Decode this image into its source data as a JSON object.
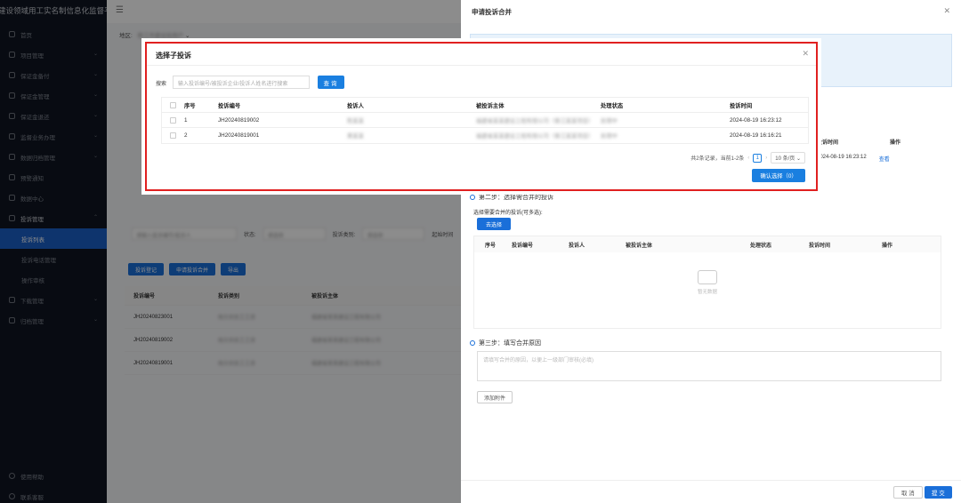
{
  "sidebar": {
    "title": "建设领域用工实名制信息化监督平台",
    "items": [
      {
        "label": "首页"
      },
      {
        "label": "项目管理"
      },
      {
        "label": "保证金备付"
      },
      {
        "label": "保证金管理"
      },
      {
        "label": "保证金退还"
      },
      {
        "label": "监督业务办理"
      },
      {
        "label": "数据归档管理"
      },
      {
        "label": "预警通知"
      },
      {
        "label": "数据中心"
      },
      {
        "label": "投诉管理"
      }
    ],
    "sub_items": [
      {
        "label": "投诉列表"
      },
      {
        "label": "投诉电话管理"
      },
      {
        "label": "操作审核"
      }
    ],
    "items_after": [
      {
        "label": "下载管理"
      },
      {
        "label": "归档管理"
      }
    ],
    "bottom": [
      {
        "label": "使用帮助"
      },
      {
        "label": "联系客服"
      }
    ]
  },
  "main": {
    "crumb_label": "地区:",
    "crumb_value": "晋江市建设局用户",
    "filters": {
      "f1": "请输入投诉编号/投诉人",
      "f2": "状态:",
      "f2v": "请选择",
      "f3": "投诉类别:",
      "f3v": "请选择",
      "f4": "起始时间"
    },
    "buttons": [
      "投诉登记",
      "申请投诉合并",
      "导出"
    ],
    "table_head": [
      "投诉编号",
      "投诉类别",
      "被投诉主体"
    ],
    "rows": [
      {
        "id": "JH20240823001",
        "cat": "拖欠农民工工资",
        "obj": "福建省某某建设工程有限公司"
      },
      {
        "id": "JH20240819002",
        "cat": "拖欠农民工工资",
        "obj": "福建省某某建设工程有限公司"
      },
      {
        "id": "JH20240819001",
        "cat": "拖欠农民工工资",
        "obj": "福建省某某建设工程有限公司"
      }
    ]
  },
  "drawer": {
    "title": "申请投诉合并",
    "right_head": [
      "投诉时间",
      "操作"
    ],
    "right_row": {
      "time": "2024-08-19 16:23:12",
      "op": "查看"
    },
    "step2": "第二步：选择需合并的投诉",
    "step2_hint": "选择需要合并的投诉(可多选):",
    "select_btn": "去选择",
    "table_head": [
      "序号",
      "投诉编号",
      "投诉人",
      "被投诉主体",
      "处理状态",
      "投诉时间",
      "操作"
    ],
    "empty": "暂无数据",
    "step3": "第三步：填写合并原因",
    "textarea_ph": "请填写合并的原因，以便上一级部门审核(必填)",
    "attach_btn": "添加附件",
    "cancel": "取 消",
    "submit": "提 交"
  },
  "dialog": {
    "title": "选择子投诉",
    "search_label": "搜索",
    "search_placeholder": "输入投诉编号/被投诉企业/投诉人姓名进行搜索",
    "query_btn": "查询",
    "head": {
      "no": "序号",
      "id": "投诉编号",
      "who": "投诉人",
      "obj": "被投诉主体",
      "status": "处理状态",
      "time": "投诉时间"
    },
    "rows": [
      {
        "no": "1",
        "id": "JH20240819002",
        "who": "陈某某",
        "obj": "福建省某某建设工程有限公司（晋江某某项目）",
        "status": "处理中",
        "time": "2024-08-19 16:23:12"
      },
      {
        "no": "2",
        "id": "JH20240819001",
        "who": "黄某某",
        "obj": "福建省某某建设工程有限公司（晋江某某项目）",
        "status": "处理中",
        "time": "2024-08-19 16:16:21"
      }
    ],
    "pager": {
      "total": "共2条记录，当前1-2条",
      "page": "1",
      "size": "10 条/页"
    },
    "confirm": "确认选择（0）"
  }
}
